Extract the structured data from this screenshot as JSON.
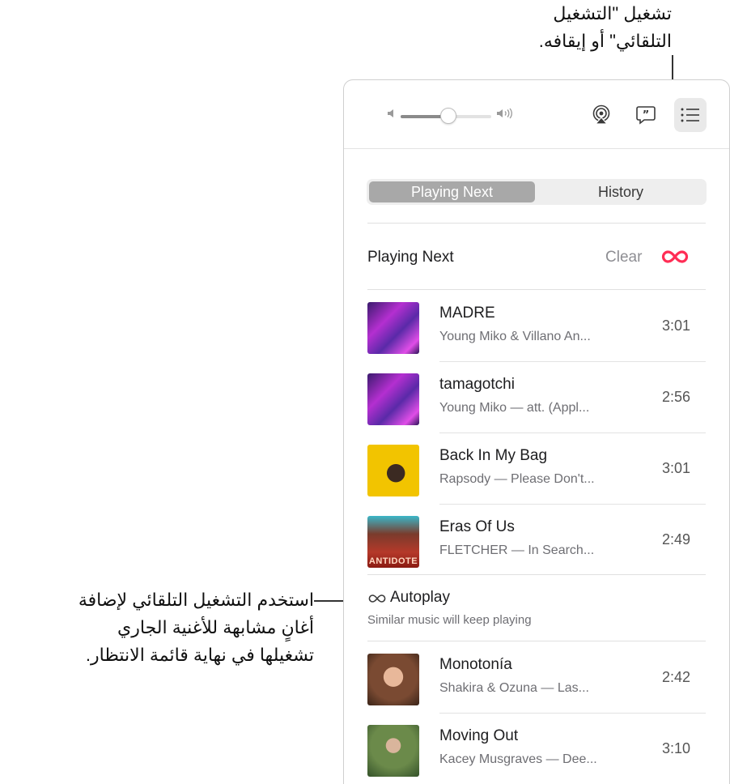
{
  "callouts": {
    "top": [
      "تشغيل \"التشغيل",
      "التلقائي\" أو إيقافه."
    ],
    "left": [
      "استخدم التشغيل التلقائي لإضافة",
      "أغانٍ مشابهة للأغنية الجاري",
      "تشغيلها في نهاية قائمة الانتظار."
    ]
  },
  "toolbar": {
    "volume_low_icon": "speaker-low-icon",
    "volume_high_icon": "speaker-high-icon",
    "volume_level": 0.55,
    "airplay_icon": "airplay-icon",
    "lyrics_icon": "lyrics-quote-icon",
    "queue_icon": "list-icon"
  },
  "tabs": [
    {
      "label": "Playing Next",
      "selected": true
    },
    {
      "label": "History",
      "selected": false
    }
  ],
  "queue": {
    "title": "Playing Next",
    "clear_label": "Clear",
    "autoplay_icon": "infinity-icon",
    "autoplay_color": "#ff2d55",
    "items": [
      {
        "title": "MADRE",
        "subtitle": "Young Miko & Villano An...",
        "duration": "3:01",
        "art": "purple"
      },
      {
        "title": "tamagotchi",
        "subtitle": "Young Miko — att. (Appl...",
        "duration": "2:56",
        "art": "purple"
      },
      {
        "title": "Back In My Bag",
        "subtitle": "Rapsody — Please Don't...",
        "duration": "3:01",
        "art": "yellow"
      },
      {
        "title": "Eras Of Us",
        "subtitle": "FLETCHER — In Search...",
        "duration": "2:49",
        "art": "red",
        "art_text": "ANTIDOTE"
      }
    ]
  },
  "autoplay": {
    "label": "Autoplay",
    "description": "Similar music will keep playing",
    "items": [
      {
        "title": "Monotonía",
        "subtitle": "Shakira & Ozuna — Las...",
        "duration": "2:42",
        "art": "warm"
      },
      {
        "title": "Moving Out",
        "subtitle": "Kacey Musgraves — Dee...",
        "duration": "3:10",
        "art": "green"
      }
    ]
  }
}
